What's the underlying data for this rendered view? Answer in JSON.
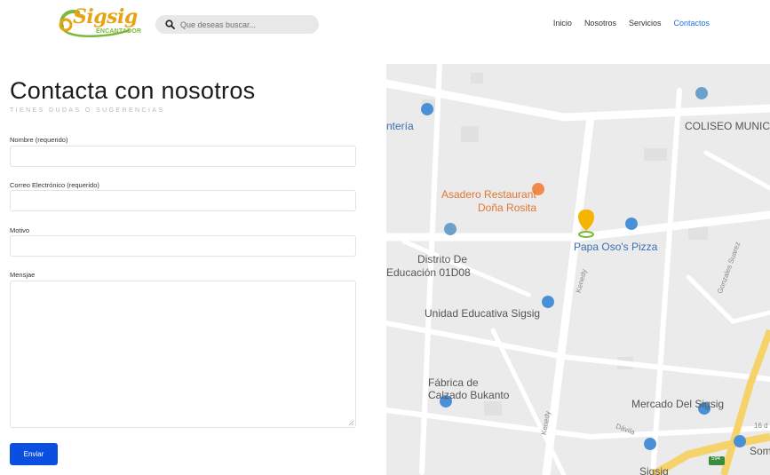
{
  "header": {
    "logo_text": "Sigsig",
    "logo_sub": "ENCANTADOR",
    "search_placeholder": "Que deseas buscar...",
    "nav": [
      {
        "label": "Inicio",
        "active": false
      },
      {
        "label": "Nosotros",
        "active": false
      },
      {
        "label": "Servicios",
        "active": false
      },
      {
        "label": "Contactos",
        "active": true
      }
    ]
  },
  "form": {
    "title": "Contacta con nosotros",
    "subtitle": "TIENES DUDAS O SUGERENCIAS",
    "name_label": "Nombre (requerido)",
    "email_label": "Correo Electrónico (requerido)",
    "reason_label": "Motivo",
    "message_label": "Mensjae",
    "submit_label": "Enviar"
  },
  "map": {
    "places": [
      "ntería",
      "COLISEO MUNICIP",
      "Asadero Restaurant",
      "Doña Rosita",
      "Papa Oso's Pizza",
      "Distrito De",
      "Educación 01D08",
      "Unidad Educativa Sigsig",
      "Fábrica de",
      "Calzado Bukanto",
      "Mercado Del Sigsig",
      "Som",
      "Sigsig"
    ],
    "streets": [
      "Kenedy",
      "Gonzales Suarez",
      "Kenedy",
      "Dávila",
      "16 d"
    ],
    "road_shield": "594"
  },
  "colors": {
    "accent": "#1f72e0",
    "button": "#0b4fe0",
    "logo_orange": "#e8a313",
    "logo_green": "#7cb83a",
    "map_bg": "#ebebeb"
  }
}
